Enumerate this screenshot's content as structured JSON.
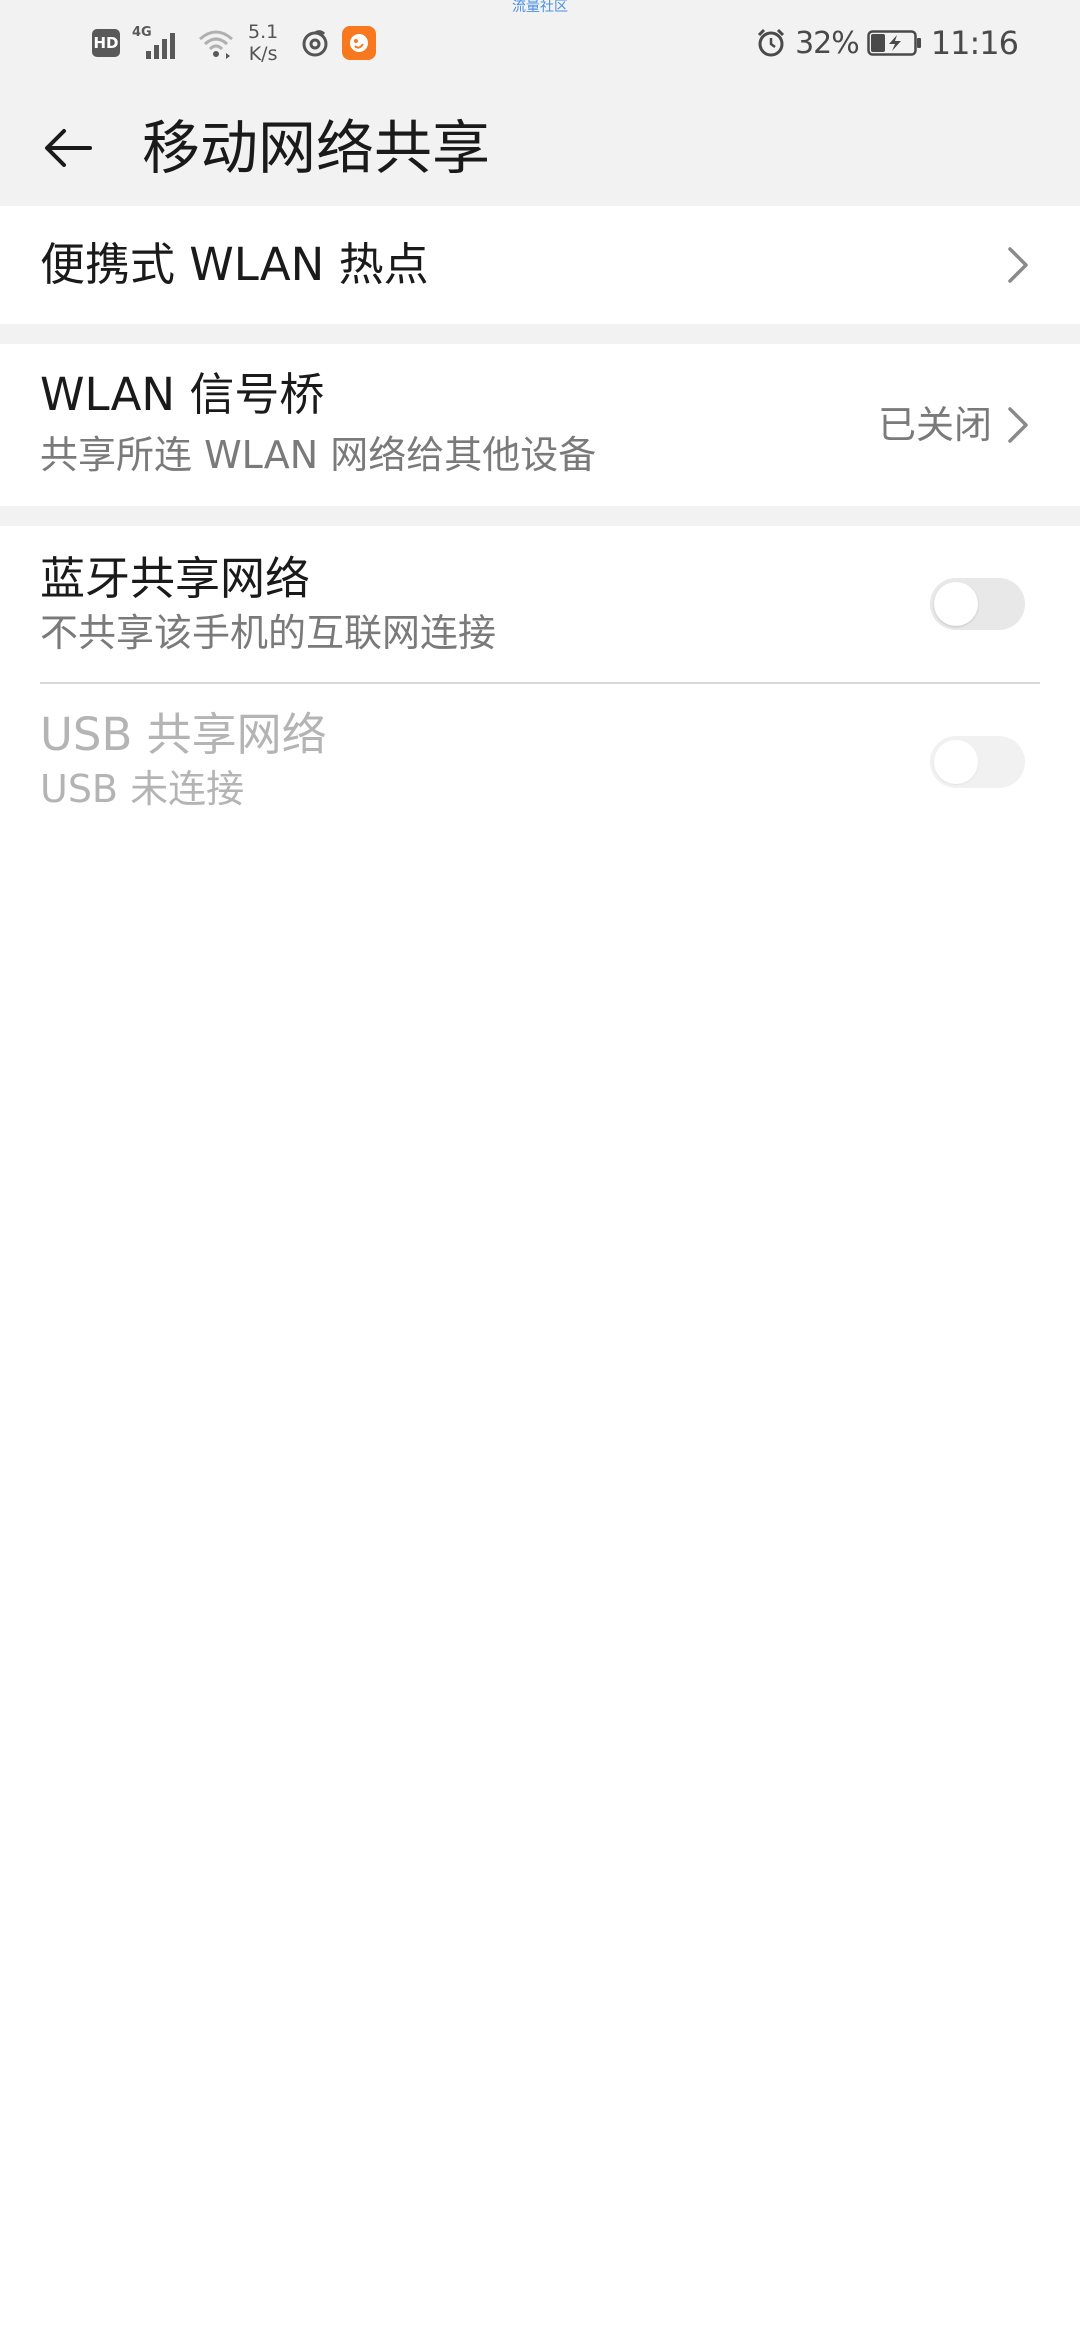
{
  "status_bar": {
    "top_note": "流量社区",
    "hd_label": "HD",
    "network_type": "4G",
    "speed_value": "5.1",
    "speed_unit": "K/s",
    "battery_percent": "32%",
    "time": "11:16",
    "icons": [
      "hd-icon",
      "signal-icon",
      "wifi-icon",
      "spiral-icon",
      "app-badge-icon",
      "alarm-icon",
      "battery-icon"
    ]
  },
  "header": {
    "title": "移动网络共享",
    "back_icon": "back-arrow-icon"
  },
  "settings": {
    "hotspot": {
      "title": "便携式 WLAN 热点"
    },
    "wlan_bridge": {
      "title": "WLAN 信号桥",
      "subtitle": "共享所连 WLAN 网络给其他设备",
      "value": "已关闭"
    },
    "bluetooth": {
      "title": "蓝牙共享网络",
      "subtitle": "不共享该手机的互联网连接",
      "enabled": false
    },
    "usb": {
      "title": "USB 共享网络",
      "subtitle": "USB 未连接",
      "enabled": false,
      "disabled": true
    }
  },
  "colors": {
    "background": "#ffffff",
    "header_bg": "#f2f2f2",
    "text_primary": "#1a1a1a",
    "text_secondary": "#7a7a7a",
    "text_disabled": "#b4b4b4",
    "toggle_off": "#e8e8e8"
  }
}
